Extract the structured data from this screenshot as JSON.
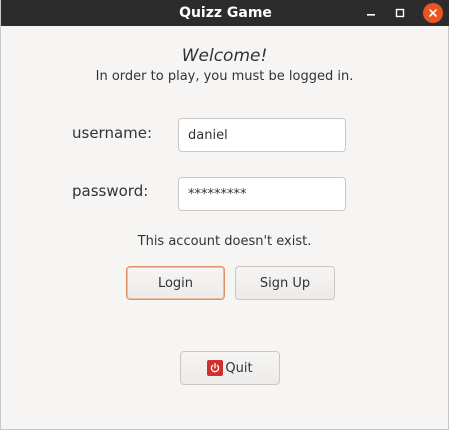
{
  "window": {
    "title": "Quizz Game"
  },
  "main": {
    "welcome": "Welcome!",
    "subtitle": "In order to play, you must be logged in.",
    "username_label": "username:",
    "username_value": "daniel",
    "password_label": "password:",
    "password_value": "*********",
    "error_message": "This account doesn't exist.",
    "login_label": "Login",
    "signup_label": "Sign Up",
    "quit_label": "Quit"
  },
  "icons": {
    "minimize": "minimize-icon",
    "maximize": "maximize-icon",
    "close": "close-icon",
    "quit": "power-icon"
  },
  "colors": {
    "titlebar": "#2c2c2c",
    "close_button": "#e95420",
    "default_button_border": "#e4906e",
    "quit_icon": "#d0312d"
  }
}
